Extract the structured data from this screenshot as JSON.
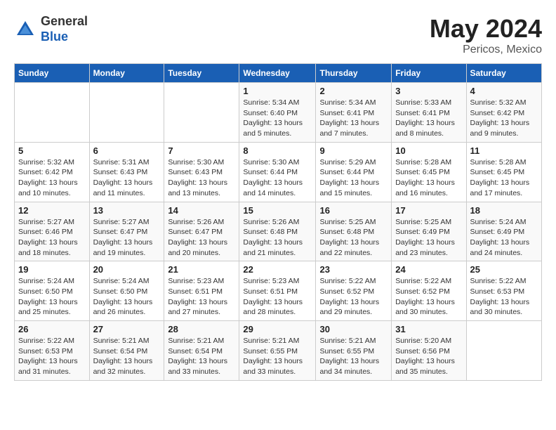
{
  "header": {
    "logo_general": "General",
    "logo_blue": "Blue",
    "month_year": "May 2024",
    "location": "Pericos, Mexico"
  },
  "days_of_week": [
    "Sunday",
    "Monday",
    "Tuesday",
    "Wednesday",
    "Thursday",
    "Friday",
    "Saturday"
  ],
  "weeks": [
    [
      {
        "day": "",
        "info": ""
      },
      {
        "day": "",
        "info": ""
      },
      {
        "day": "",
        "info": ""
      },
      {
        "day": "1",
        "info": "Sunrise: 5:34 AM\nSunset: 6:40 PM\nDaylight: 13 hours\nand 5 minutes."
      },
      {
        "day": "2",
        "info": "Sunrise: 5:34 AM\nSunset: 6:41 PM\nDaylight: 13 hours\nand 7 minutes."
      },
      {
        "day": "3",
        "info": "Sunrise: 5:33 AM\nSunset: 6:41 PM\nDaylight: 13 hours\nand 8 minutes."
      },
      {
        "day": "4",
        "info": "Sunrise: 5:32 AM\nSunset: 6:42 PM\nDaylight: 13 hours\nand 9 minutes."
      }
    ],
    [
      {
        "day": "5",
        "info": "Sunrise: 5:32 AM\nSunset: 6:42 PM\nDaylight: 13 hours\nand 10 minutes."
      },
      {
        "day": "6",
        "info": "Sunrise: 5:31 AM\nSunset: 6:43 PM\nDaylight: 13 hours\nand 11 minutes."
      },
      {
        "day": "7",
        "info": "Sunrise: 5:30 AM\nSunset: 6:43 PM\nDaylight: 13 hours\nand 13 minutes."
      },
      {
        "day": "8",
        "info": "Sunrise: 5:30 AM\nSunset: 6:44 PM\nDaylight: 13 hours\nand 14 minutes."
      },
      {
        "day": "9",
        "info": "Sunrise: 5:29 AM\nSunset: 6:44 PM\nDaylight: 13 hours\nand 15 minutes."
      },
      {
        "day": "10",
        "info": "Sunrise: 5:28 AM\nSunset: 6:45 PM\nDaylight: 13 hours\nand 16 minutes."
      },
      {
        "day": "11",
        "info": "Sunrise: 5:28 AM\nSunset: 6:45 PM\nDaylight: 13 hours\nand 17 minutes."
      }
    ],
    [
      {
        "day": "12",
        "info": "Sunrise: 5:27 AM\nSunset: 6:46 PM\nDaylight: 13 hours\nand 18 minutes."
      },
      {
        "day": "13",
        "info": "Sunrise: 5:27 AM\nSunset: 6:47 PM\nDaylight: 13 hours\nand 19 minutes."
      },
      {
        "day": "14",
        "info": "Sunrise: 5:26 AM\nSunset: 6:47 PM\nDaylight: 13 hours\nand 20 minutes."
      },
      {
        "day": "15",
        "info": "Sunrise: 5:26 AM\nSunset: 6:48 PM\nDaylight: 13 hours\nand 21 minutes."
      },
      {
        "day": "16",
        "info": "Sunrise: 5:25 AM\nSunset: 6:48 PM\nDaylight: 13 hours\nand 22 minutes."
      },
      {
        "day": "17",
        "info": "Sunrise: 5:25 AM\nSunset: 6:49 PM\nDaylight: 13 hours\nand 23 minutes."
      },
      {
        "day": "18",
        "info": "Sunrise: 5:24 AM\nSunset: 6:49 PM\nDaylight: 13 hours\nand 24 minutes."
      }
    ],
    [
      {
        "day": "19",
        "info": "Sunrise: 5:24 AM\nSunset: 6:50 PM\nDaylight: 13 hours\nand 25 minutes."
      },
      {
        "day": "20",
        "info": "Sunrise: 5:24 AM\nSunset: 6:50 PM\nDaylight: 13 hours\nand 26 minutes."
      },
      {
        "day": "21",
        "info": "Sunrise: 5:23 AM\nSunset: 6:51 PM\nDaylight: 13 hours\nand 27 minutes."
      },
      {
        "day": "22",
        "info": "Sunrise: 5:23 AM\nSunset: 6:51 PM\nDaylight: 13 hours\nand 28 minutes."
      },
      {
        "day": "23",
        "info": "Sunrise: 5:22 AM\nSunset: 6:52 PM\nDaylight: 13 hours\nand 29 minutes."
      },
      {
        "day": "24",
        "info": "Sunrise: 5:22 AM\nSunset: 6:52 PM\nDaylight: 13 hours\nand 30 minutes."
      },
      {
        "day": "25",
        "info": "Sunrise: 5:22 AM\nSunset: 6:53 PM\nDaylight: 13 hours\nand 30 minutes."
      }
    ],
    [
      {
        "day": "26",
        "info": "Sunrise: 5:22 AM\nSunset: 6:53 PM\nDaylight: 13 hours\nand 31 minutes."
      },
      {
        "day": "27",
        "info": "Sunrise: 5:21 AM\nSunset: 6:54 PM\nDaylight: 13 hours\nand 32 minutes."
      },
      {
        "day": "28",
        "info": "Sunrise: 5:21 AM\nSunset: 6:54 PM\nDaylight: 13 hours\nand 33 minutes."
      },
      {
        "day": "29",
        "info": "Sunrise: 5:21 AM\nSunset: 6:55 PM\nDaylight: 13 hours\nand 33 minutes."
      },
      {
        "day": "30",
        "info": "Sunrise: 5:21 AM\nSunset: 6:55 PM\nDaylight: 13 hours\nand 34 minutes."
      },
      {
        "day": "31",
        "info": "Sunrise: 5:20 AM\nSunset: 6:56 PM\nDaylight: 13 hours\nand 35 minutes."
      },
      {
        "day": "",
        "info": ""
      }
    ]
  ]
}
